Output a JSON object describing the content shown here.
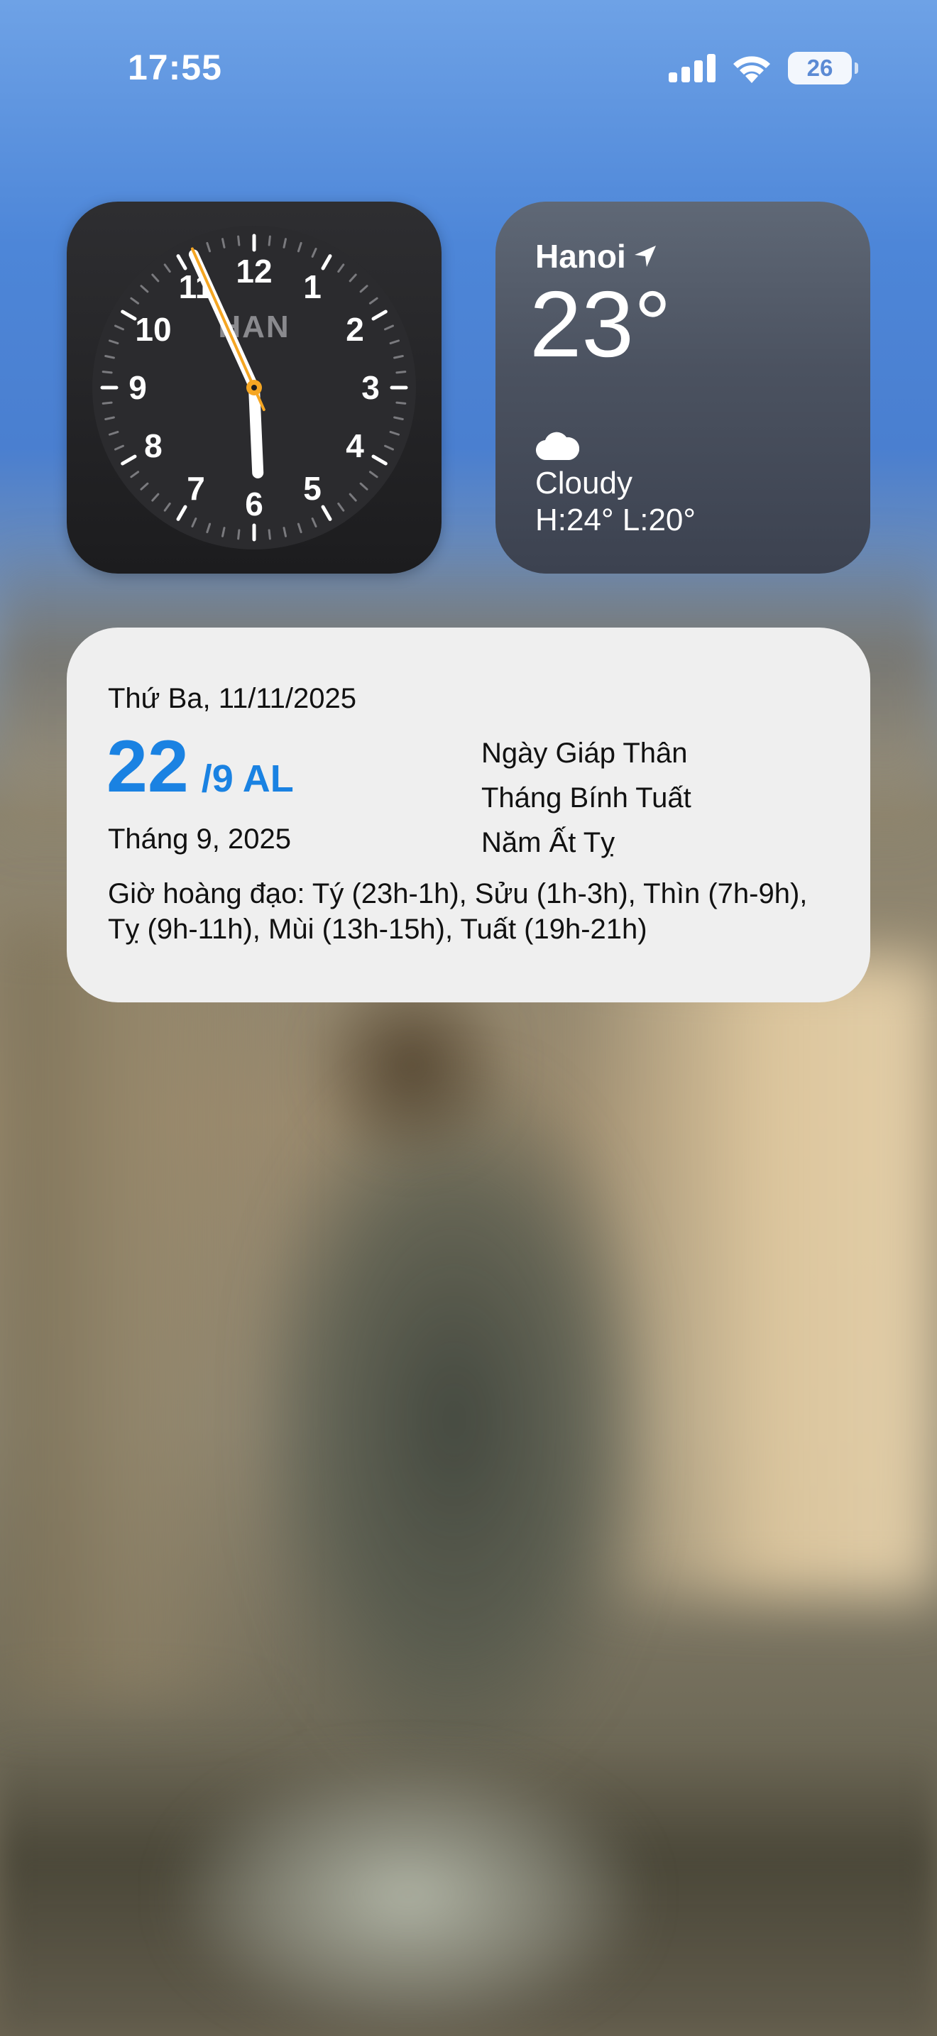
{
  "status_bar": {
    "time": "17:55",
    "battery_level": "26",
    "icons": [
      "cellular-signal-icon",
      "wifi-icon",
      "battery-icon"
    ]
  },
  "clock_widget": {
    "city_code": "HAN",
    "numbers": [
      "12",
      "1",
      "2",
      "3",
      "4",
      "5",
      "6",
      "7",
      "8",
      "9",
      "10",
      "11"
    ],
    "time": {
      "hour": 5,
      "minute": 55,
      "second": 56
    },
    "second_hand_color": "#f5a623"
  },
  "weather_widget": {
    "city": "Hanoi",
    "temperature": "23°",
    "condition": "Cloudy",
    "high_low": "H:24° L:20°",
    "icons": [
      "location-arrow-icon",
      "cloud-icon"
    ]
  },
  "calendar_widget": {
    "solar_date": "Thứ Ba, 11/11/2025",
    "lunar_day": "22",
    "lunar_month": "/9 AL",
    "lunar_month_year": "Tháng 9, 2025",
    "can_chi_day": "Ngày Giáp Thân",
    "can_chi_month": "Tháng Bính Tuất",
    "can_chi_year": "Năm Ất Tỵ",
    "auspicious_hours": "Giờ hoàng đạo: Tý (23h-1h), Sửu (1h-3h), Thìn (7h-9h), Tỵ (9h-11h), Mùi (13h-15h), Tuất (19h-21h)",
    "accent_color": "#1a82e2"
  }
}
